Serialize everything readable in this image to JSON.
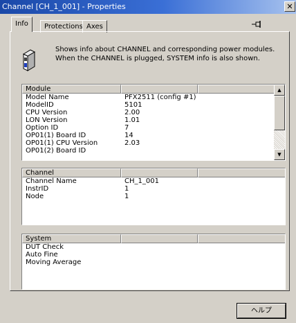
{
  "window": {
    "title": "Channel [CH_1_001] - Properties",
    "close_glyph": "✕"
  },
  "tabs": [
    {
      "label": "Info",
      "selected": true
    },
    {
      "label": "Protections",
      "selected": false
    },
    {
      "label": "Axes",
      "selected": false
    }
  ],
  "pin_icon": "pin-icon",
  "info_text": "Shows info about CHANNEL and corresponding power modules.  When the CHANNEL is plugged, SYSTEM info is also shown.",
  "module": {
    "header": [
      "Module",
      "",
      ""
    ],
    "rows": [
      [
        "Model Name",
        "PFX2511 (config #1)"
      ],
      [
        "ModelID",
        "5101"
      ],
      [
        "CPU Version",
        "2.00"
      ],
      [
        "LON Version",
        "1.01"
      ],
      [
        "Option ID",
        "7"
      ],
      [
        "OP01(1) Board ID",
        "14"
      ],
      [
        "OP01(1) CPU Version",
        "2.03"
      ],
      [
        "OP01(2) Board ID",
        ""
      ]
    ]
  },
  "channel": {
    "header": [
      "Channel",
      "",
      ""
    ],
    "rows": [
      [
        "Channel Name",
        "CH_1_001"
      ],
      [
        "InstrID",
        "1"
      ],
      [
        "Node",
        "1"
      ]
    ]
  },
  "system": {
    "header": [
      "System",
      "",
      ""
    ],
    "rows": [
      [
        "DUT Check",
        ""
      ],
      [
        "Auto Fine",
        ""
      ],
      [
        "Moving Average",
        ""
      ]
    ]
  },
  "buttons": {
    "help": "ヘルプ"
  },
  "colors": {
    "title_start": "#1a48a8",
    "title_end": "#a7c2ee",
    "face": "#d4d0c8"
  }
}
